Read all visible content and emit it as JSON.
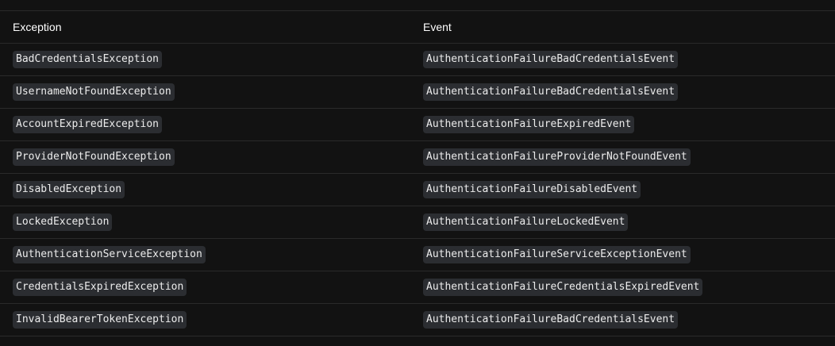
{
  "table": {
    "headers": {
      "exception": "Exception",
      "event": "Event"
    },
    "rows": [
      {
        "exception": "BadCredentialsException",
        "event": "AuthenticationFailureBadCredentialsEvent"
      },
      {
        "exception": "UsernameNotFoundException",
        "event": "AuthenticationFailureBadCredentialsEvent"
      },
      {
        "exception": "AccountExpiredException",
        "event": "AuthenticationFailureExpiredEvent"
      },
      {
        "exception": "ProviderNotFoundException",
        "event": "AuthenticationFailureProviderNotFoundEvent"
      },
      {
        "exception": "DisabledException",
        "event": "AuthenticationFailureDisabledEvent"
      },
      {
        "exception": "LockedException",
        "event": "AuthenticationFailureLockedEvent"
      },
      {
        "exception": "AuthenticationServiceException",
        "event": "AuthenticationFailureServiceExceptionEvent"
      },
      {
        "exception": "CredentialsExpiredException",
        "event": "AuthenticationFailureCredentialsExpiredEvent"
      },
      {
        "exception": "InvalidBearerTokenException",
        "event": "AuthenticationFailureBadCredentialsEvent"
      }
    ]
  }
}
